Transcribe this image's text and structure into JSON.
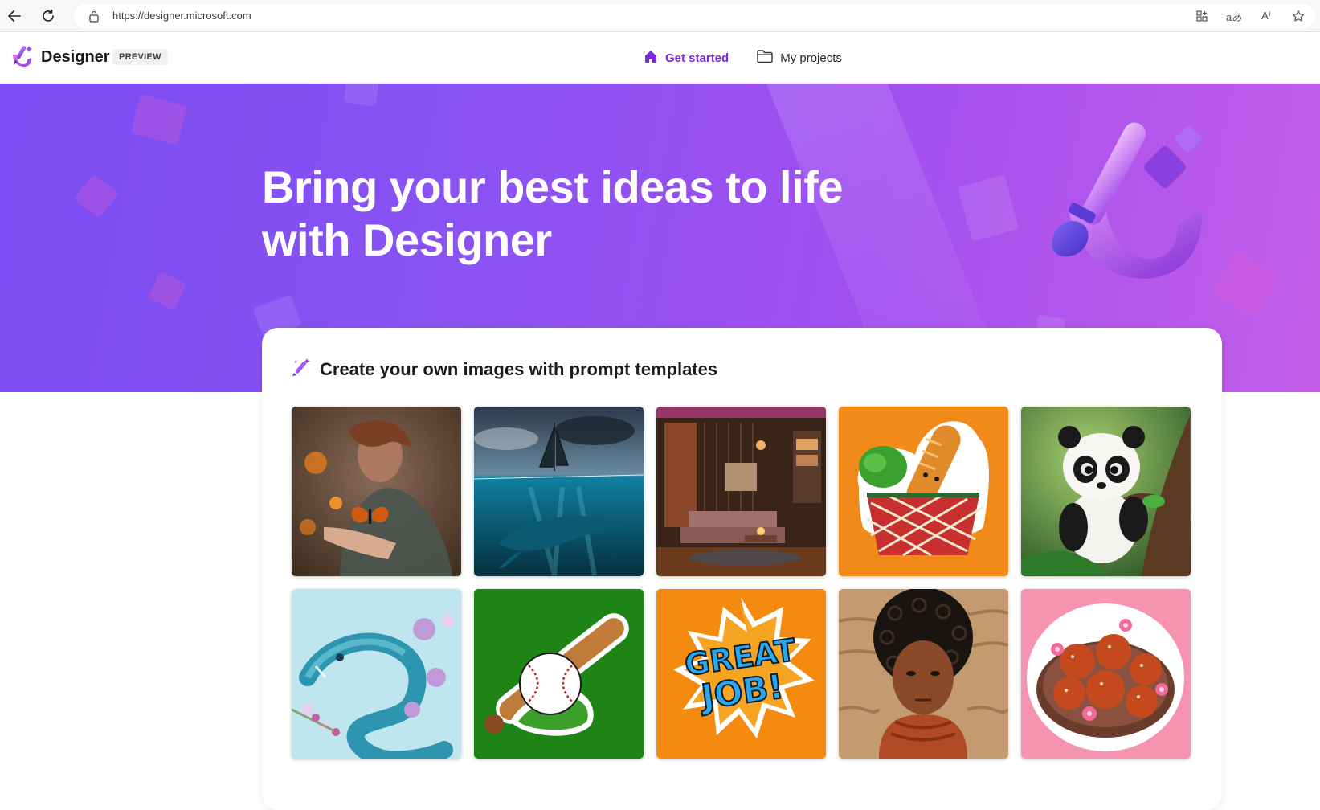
{
  "browser": {
    "url": "https://designer.microsoft.com",
    "read_aloud_label": "A⁾",
    "translate_label": "aあ"
  },
  "header": {
    "brand": "Designer",
    "badge": "PREVIEW",
    "nav": [
      {
        "label": "Get started",
        "icon": "home-icon",
        "active": true
      },
      {
        "label": "My projects",
        "icon": "folder-icon",
        "active": false
      }
    ]
  },
  "hero": {
    "title_line1": "Bring your best ideas to life",
    "title_line2": "with Designer"
  },
  "templates": {
    "heading": "Create your own images with prompt templates",
    "items": [
      {
        "name": "woman-with-butterfly",
        "gallery_icon": "butterfly-photo"
      },
      {
        "name": "whale-under-sailboat",
        "gallery_icon": "ocean-photo"
      },
      {
        "name": "cozy-living-room",
        "gallery_icon": "interior-photo"
      },
      {
        "name": "grocery-basket-sticker",
        "gallery_icon": "sticker"
      },
      {
        "name": "panda-on-tree",
        "gallery_icon": "panda-photo"
      },
      {
        "name": "paper-iguana",
        "gallery_icon": "paper-art"
      },
      {
        "name": "baseball-bat-sticker",
        "gallery_icon": "sticker"
      },
      {
        "name": "great-job-badge",
        "gallery_icon": "comic-text"
      },
      {
        "name": "curly-hair-portrait",
        "gallery_icon": "carved-portrait"
      },
      {
        "name": "pastry-bowl-sticker",
        "gallery_icon": "sticker"
      }
    ],
    "great_job_text_1": "GREAT",
    "great_job_text_2": "JOB!"
  },
  "colors": {
    "accent": "#7a2ae0",
    "hero_start": "#7b4df2",
    "hero_end": "#c35de9"
  }
}
